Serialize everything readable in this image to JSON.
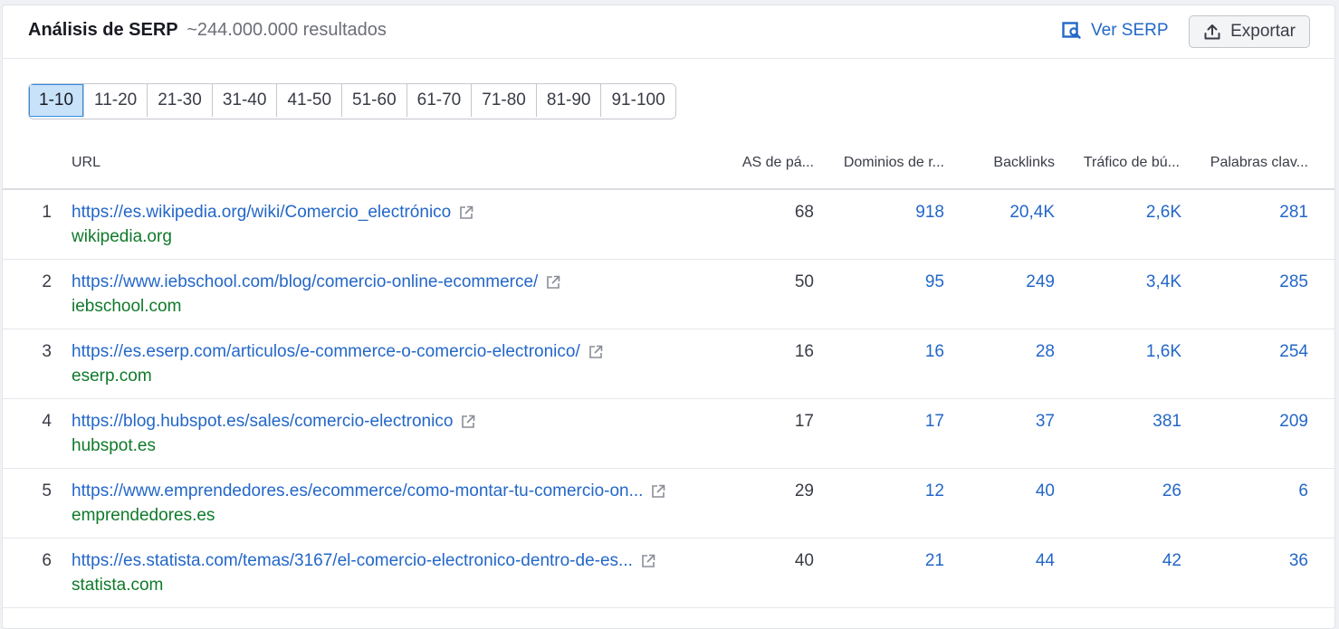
{
  "header": {
    "title": "Análisis de SERP",
    "results": "~244.000.000 resultados",
    "ver_serp_label": "Ver SERP",
    "export_label": "Exportar"
  },
  "pagination": {
    "pages": [
      "1-10",
      "11-20",
      "21-30",
      "31-40",
      "41-50",
      "51-60",
      "61-70",
      "71-80",
      "81-90",
      "91-100"
    ],
    "active": "1-10"
  },
  "table": {
    "columns": {
      "url": "URL",
      "as": "AS de pá...",
      "dominios": "Dominios de r...",
      "backlinks": "Backlinks",
      "trafico": "Tráfico de bú...",
      "palabras": "Palabras clav..."
    },
    "rows": [
      {
        "rank": "1",
        "url": "https://es.wikipedia.org/wiki/Comercio_electrónico",
        "domain": "wikipedia.org",
        "as": "68",
        "dominios": "918",
        "backlinks": "20,4K",
        "trafico": "2,6K",
        "palabras": "281"
      },
      {
        "rank": "2",
        "url": "https://www.iebschool.com/blog/comercio-online-ecommerce/",
        "domain": "iebschool.com",
        "as": "50",
        "dominios": "95",
        "backlinks": "249",
        "trafico": "3,4K",
        "palabras": "285"
      },
      {
        "rank": "3",
        "url": "https://es.eserp.com/articulos/e-commerce-o-comercio-electronico/",
        "domain": "eserp.com",
        "as": "16",
        "dominios": "16",
        "backlinks": "28",
        "trafico": "1,6K",
        "palabras": "254"
      },
      {
        "rank": "4",
        "url": "https://blog.hubspot.es/sales/comercio-electronico",
        "domain": "hubspot.es",
        "as": "17",
        "dominios": "17",
        "backlinks": "37",
        "trafico": "381",
        "palabras": "209"
      },
      {
        "rank": "5",
        "url": "https://www.emprendedores.es/ecommerce/como-montar-tu-comercio-on...",
        "domain": "emprendedores.es",
        "as": "29",
        "dominios": "12",
        "backlinks": "40",
        "trafico": "26",
        "palabras": "6"
      },
      {
        "rank": "6",
        "url": "https://es.statista.com/temas/3167/el-comercio-electronico-dentro-de-es...",
        "domain": "statista.com",
        "as": "40",
        "dominios": "21",
        "backlinks": "44",
        "trafico": "42",
        "palabras": "36"
      }
    ]
  },
  "colors": {
    "link": "#2367c8",
    "domain": "#0f7a2a",
    "active_page_bg": "#c8e2fa"
  },
  "icons": {
    "ver_serp": "serp-preview-icon",
    "export": "upload-icon",
    "url": "external-link-icon"
  }
}
